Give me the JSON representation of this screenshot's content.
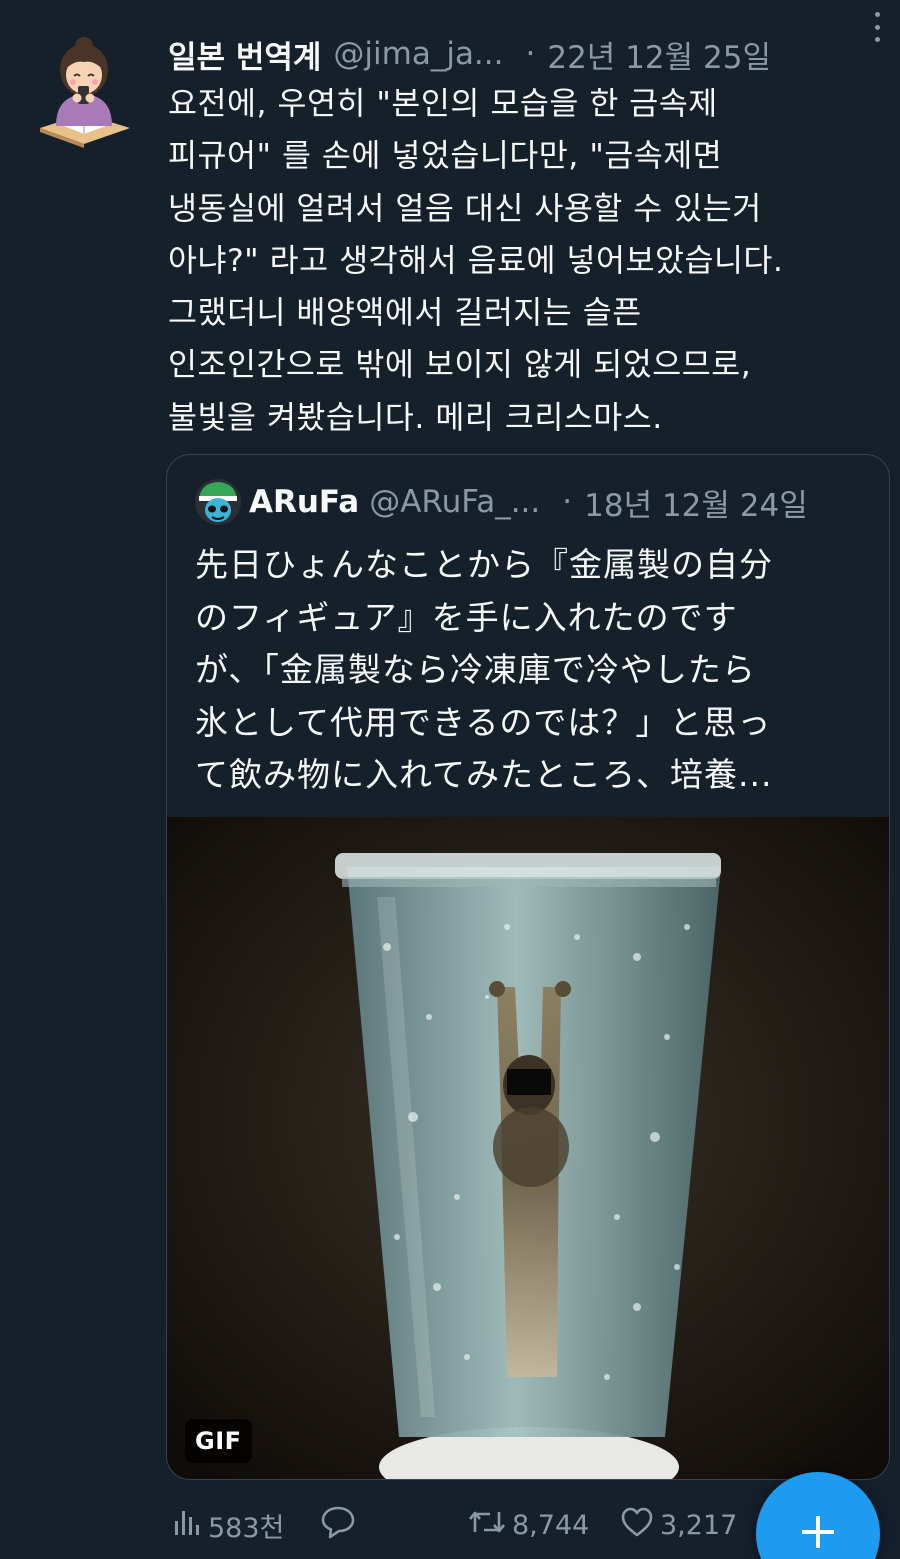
{
  "tweet": {
    "display_name": "일본 번역계",
    "handle": "@jima_ja...",
    "separator": "·",
    "date": "22년 12월 25일",
    "lines": [
      "요전에, 우연히 \"본인의 모습을 한 금속제",
      "피규어\" 를 손에 넣었습니다만, \"금속제면",
      "냉동실에 얼려서 얼음 대신 사용할 수 있는거",
      "아냐?\" 라고 생각해서 음료에 넣어보았습니다.",
      "그랬더니 배양액에서 길러지는 슬픈",
      "인조인간으로 밖에 보이지 않게 되었으므로,",
      "불빛을 켜봤습니다. 메리 크리스마스."
    ]
  },
  "quote": {
    "display_name": "ARuFa",
    "handle": "@ARuFa_...",
    "separator": "·",
    "date": "18년 12월 24일",
    "lines": [
      "先日ひょんなことから『金属製の自分",
      "のフィギュア』を手に入れたのです",
      "が、「金属製なら冷凍庫で冷やしたら",
      "氷として代用できるのでは？」と思っ",
      "て飲み物に入れてみたところ、培養..."
    ],
    "media_badge": "GIF"
  },
  "actions": {
    "views": "583천",
    "replies": "",
    "retweets": "8,744",
    "likes": "3,217"
  },
  "colors": {
    "background": "#15202b",
    "text": "#f7f9f9",
    "secondary": "#8b98a5",
    "border": "#38444d",
    "accent": "#1d9bf0"
  },
  "icons": {
    "more": "more-dots-icon",
    "views": "bar-chart-icon",
    "reply": "speech-bubble-icon",
    "retweet": "retweet-icon",
    "like": "heart-icon",
    "compose": "plus-icon"
  }
}
